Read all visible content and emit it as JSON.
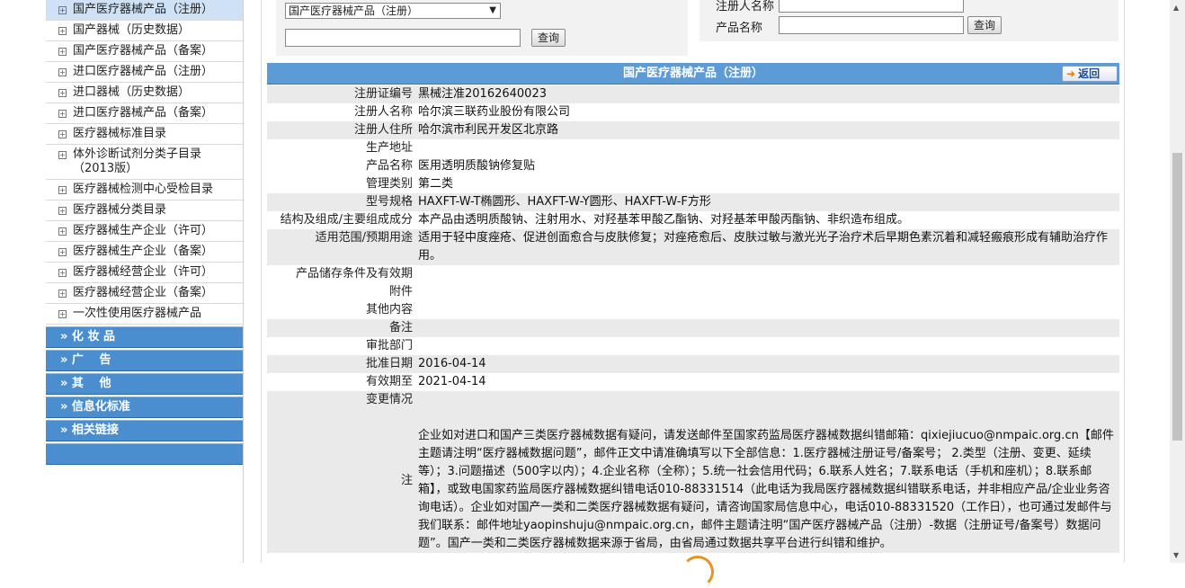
{
  "sidebar": {
    "items": [
      {
        "label": "国产医疗器械产品（注册）",
        "active": true
      },
      {
        "label": "国产器械（历史数据）"
      },
      {
        "label": "国产医疗器械产品（备案）"
      },
      {
        "label": "进口医疗器械产品（注册）"
      },
      {
        "label": "进口器械（历史数据）"
      },
      {
        "label": "进口医疗器械产品（备案）"
      },
      {
        "label": "医疗器械标准目录"
      },
      {
        "label": "体外诊断试剂分类子目录（2013版）"
      },
      {
        "label": "医疗器械检测中心受检目录"
      },
      {
        "label": "医疗器械分类目录"
      },
      {
        "label": "医疗器械生产企业（许可）"
      },
      {
        "label": "医疗器械生产企业（备案）"
      },
      {
        "label": "医疗器械经营企业（许可）"
      },
      {
        "label": "医疗器械经营企业（备案）"
      },
      {
        "label": "一次性使用医疗器械产品"
      }
    ],
    "categories": [
      "» 化 妆 品",
      "» 广　 告",
      "» 其　 他",
      "» 信息化标准",
      "» 相关链接"
    ]
  },
  "search": {
    "select_value": "国产医疗器械产品（注册）",
    "query_button": "查询",
    "registrant_label": "注册人名称",
    "product_label": "产品名称",
    "query_button2": "查询"
  },
  "panel": {
    "title": "国产医疗器械产品（注册）",
    "back_label": "返回"
  },
  "detail": {
    "rows": [
      {
        "k": "注册证编号",
        "v": "黑械注准20162640023"
      },
      {
        "k": "注册人名称",
        "v": "哈尔滨三联药业股份有限公司"
      },
      {
        "k": "注册人住所",
        "v": "哈尔滨市利民开发区北京路"
      },
      {
        "k": "生产地址",
        "v": ""
      },
      {
        "k": "产品名称",
        "v": "医用透明质酸钠修复贴"
      },
      {
        "k": "管理类别",
        "v": "第二类"
      },
      {
        "k": "型号规格",
        "v": "HAXFT-W-T椭圆形、HAXFT-W-Y圆形、HAXFT-W-F方形"
      },
      {
        "k": "结构及组成/主要组成成分",
        "v": "本产品由透明质酸钠、注射用水、对羟基苯甲酸乙酯钠、对羟基苯甲酸丙酯钠、非织造布组成。"
      },
      {
        "k": "适用范围/预期用途",
        "v": "适用于轻中度痤疮、促进创面愈合与皮肤修复；对痤疮愈后、皮肤过敏与激光光子治疗术后早期色素沉着和减轻瘢痕形成有辅助治疗作用。"
      },
      {
        "k": "产品储存条件及有效期",
        "v": ""
      },
      {
        "k": "附件",
        "v": ""
      },
      {
        "k": "其他内容",
        "v": ""
      },
      {
        "k": "备注",
        "v": ""
      },
      {
        "k": "审批部门",
        "v": ""
      },
      {
        "k": "批准日期",
        "v": "2016-04-14"
      },
      {
        "k": "有效期至",
        "v": "2021-04-14"
      },
      {
        "k": "变更情况",
        "v": ""
      }
    ],
    "note_label": "注",
    "note_text": "企业如对进口和国产三类医疗器械数据有疑问，请发送邮件至国家药监局医疗器械数据纠错邮箱：qixiejiucuo@nmpaic.org.cn【邮件主题请注明“医疗器械数据问题”，邮件正文中请准确填写以下全部信息：1.医疗器械注册证号/备案号； 2.类型（注册、变更、延续等）；3.问题描述（500字以内）；4.企业名称（全称）；5.统一社会信用代码；6.联系人姓名；7.联系电话（手机和座机）；8.联系邮箱】，或致电国家药监局医疗器械数据纠错电话010-88331514（此电话为我局医疗器械数据纠错联系电话，并非相应产品/企业业务咨询电话）。企业如对国产一类和二类医疗器械数据有疑问，请咨询国家局信息中心，电话010-88331520（工作日），也可通过发邮件与我们联系：邮件地址yaopinshuju@nmpaic.org.cn，邮件主题请注明“国产医疗器械产品（注册）-数据（注册证号/备案号）数据问题”。国产一类和二类医疗器械数据来源于省局，由省局通过数据共享平台进行纠错和维护。"
  },
  "colors": {
    "header_blue": "#5d9bd6",
    "category_blue": "#4a8ed0",
    "row_alt": "#eaeaea"
  }
}
